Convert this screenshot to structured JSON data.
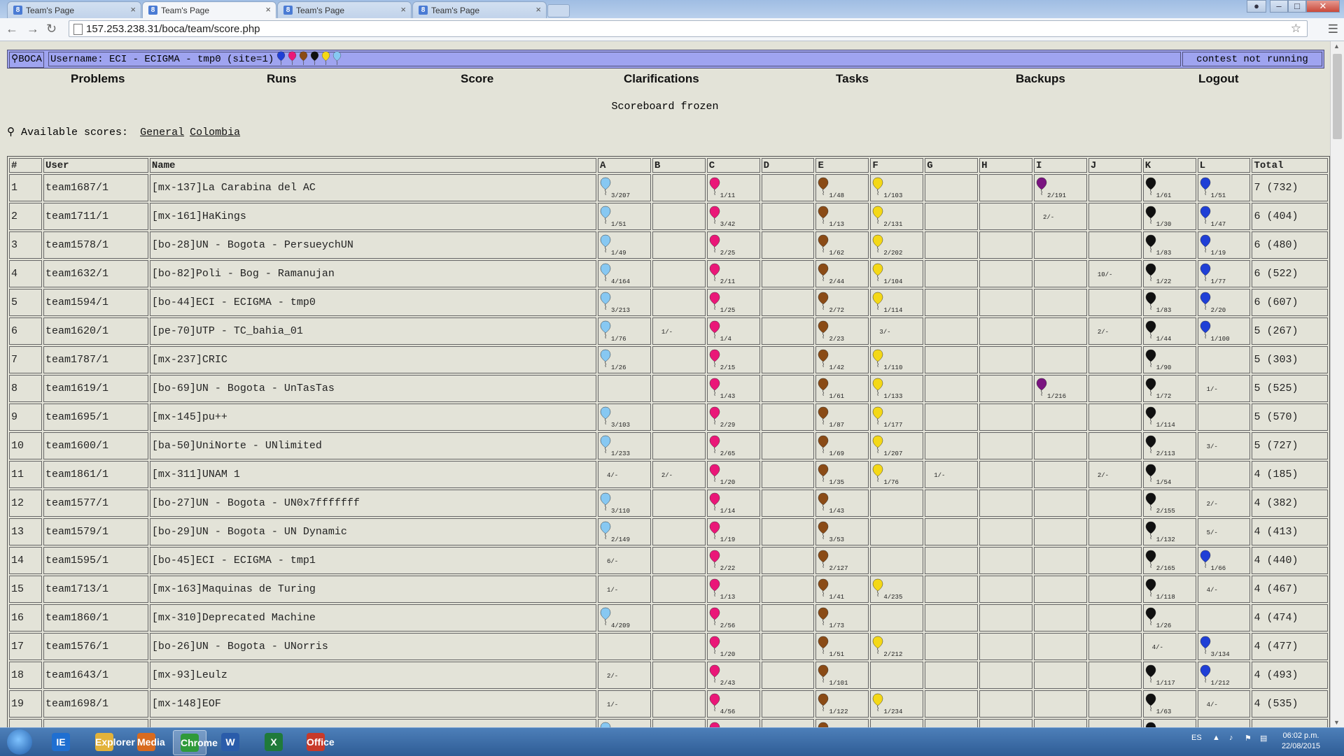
{
  "browser": {
    "tabs": [
      {
        "label": "Team's Page",
        "active": false
      },
      {
        "label": "Team's Page",
        "active": true
      },
      {
        "label": "Team's Page",
        "active": false
      },
      {
        "label": "Team's Page",
        "active": false
      }
    ],
    "close_glyph": "×",
    "url": "157.253.238.31/boca/team/score.php"
  },
  "header": {
    "logo": "BOCA",
    "username": "Username: ECI - ECIGMA - tmp0 (site=1)",
    "status": "contest not running",
    "balloon_colors": [
      "#1f3fd6",
      "#ea1778",
      "#8a4b16",
      "#101010",
      "#f4d817",
      "#87c8f2"
    ]
  },
  "menu": [
    "Problems",
    "Runs",
    "Score",
    "Clarifications",
    "Tasks",
    "Backups",
    "Logout"
  ],
  "notice": "Scoreboard frozen",
  "scores": {
    "label": "Available scores:",
    "links": [
      "General",
      "Colombia"
    ]
  },
  "colors": {
    "A": "#87c8f2",
    "B": "#ffffff",
    "C": "#ea1778",
    "D": "#ffffff",
    "E": "#8a4b16",
    "F": "#f4d817",
    "G": "#ffffff",
    "H": "#ffffff",
    "I": "#7a1480",
    "J": "#ffffff",
    "K": "#101010",
    "L": "#1f3fd6"
  },
  "table": {
    "columns": [
      "#",
      "User",
      "Name",
      "A",
      "B",
      "C",
      "D",
      "E",
      "F",
      "G",
      "H",
      "I",
      "J",
      "K",
      "L",
      "Total"
    ],
    "rows": [
      {
        "rank": "1",
        "user": "team1687/1",
        "name": "[mx-137]La Carabina del AC",
        "total": "7 (732)",
        "cells": [
          "b:3/207",
          "",
          "b:1/11",
          "",
          "b:1/48",
          "b:1/103",
          "",
          "",
          "b:2/191",
          "",
          "b:1/61",
          "b:1/51"
        ]
      },
      {
        "rank": "2",
        "user": "team1711/1",
        "name": "[mx-161]HaKings",
        "total": "6 (404)",
        "cells": [
          "b:1/51",
          "",
          "b:3/42",
          "",
          "b:1/13",
          "b:2/131",
          "",
          "",
          "t:2/-",
          "",
          "b:1/30",
          "b:1/47"
        ]
      },
      {
        "rank": "3",
        "user": "team1578/1",
        "name": "[bo-28]UN - Bogota - PersueychUN",
        "total": "6 (480)",
        "cells": [
          "b:1/49",
          "",
          "b:2/25",
          "",
          "b:1/62",
          "b:2/202",
          "",
          "",
          "",
          "",
          "b:1/83",
          "b:1/19"
        ]
      },
      {
        "rank": "4",
        "user": "team1632/1",
        "name": "[bo-82]Poli - Bog - Ramanujan",
        "total": "6 (522)",
        "cells": [
          "b:4/164",
          "",
          "b:2/11",
          "",
          "b:2/44",
          "b:1/104",
          "",
          "",
          "",
          "t:10/-",
          "b:1/22",
          "b:1/77"
        ]
      },
      {
        "rank": "5",
        "user": "team1594/1",
        "name": "[bo-44]ECI - ECIGMA - tmp0",
        "total": "6 (607)",
        "cells": [
          "b:3/213",
          "",
          "b:1/25",
          "",
          "b:2/72",
          "b:1/114",
          "",
          "",
          "",
          "",
          "b:1/83",
          "b:2/20"
        ]
      },
      {
        "rank": "6",
        "user": "team1620/1",
        "name": "[pe-70]UTP - TC_bahia_01",
        "total": "5 (267)",
        "cells": [
          "b:1/76",
          "t:1/-",
          "b:1/4",
          "",
          "b:2/23",
          "t:3/-",
          "",
          "",
          "",
          "t:2/-",
          "b:1/44",
          "b:1/100"
        ]
      },
      {
        "rank": "7",
        "user": "team1787/1",
        "name": "[mx-237]CRIC",
        "total": "5 (303)",
        "cells": [
          "b:1/26",
          "",
          "b:2/15",
          "",
          "b:1/42",
          "b:1/110",
          "",
          "",
          "",
          "",
          "b:1/90",
          ""
        ]
      },
      {
        "rank": "8",
        "user": "team1619/1",
        "name": "[bo-69]UN - Bogota - UnTasTas",
        "total": "5 (525)",
        "cells": [
          "",
          "",
          "b:1/43",
          "",
          "b:1/61",
          "b:1/133",
          "",
          "",
          "b:1/216",
          "",
          "b:1/72",
          "t:1/-"
        ]
      },
      {
        "rank": "9",
        "user": "team1695/1",
        "name": "[mx-145]pu++",
        "total": "5 (570)",
        "cells": [
          "b:3/103",
          "",
          "b:2/29",
          "",
          "b:1/87",
          "b:1/177",
          "",
          "",
          "",
          "",
          "b:1/114",
          ""
        ]
      },
      {
        "rank": "10",
        "user": "team1600/1",
        "name": "[ba-50]UniNorte - UNlimited",
        "total": "5 (727)",
        "cells": [
          "b:1/233",
          "",
          "b:2/65",
          "",
          "b:1/69",
          "b:1/207",
          "",
          "",
          "",
          "",
          "b:2/113",
          "t:3/-"
        ]
      },
      {
        "rank": "11",
        "user": "team1861/1",
        "name": "[mx-311]UNAM 1",
        "total": "4 (185)",
        "cells": [
          "t:4/-",
          "t:2/-",
          "b:1/20",
          "",
          "b:1/35",
          "b:1/76",
          "t:1/-",
          "",
          "",
          "t:2/-",
          "b:1/54",
          ""
        ]
      },
      {
        "rank": "12",
        "user": "team1577/1",
        "name": "[bo-27]UN - Bogota - UN0x7fffffff",
        "total": "4 (382)",
        "cells": [
          "b:3/110",
          "",
          "b:1/14",
          "",
          "b:1/43",
          "",
          "",
          "",
          "",
          "",
          "b:2/155",
          "t:2/-"
        ]
      },
      {
        "rank": "13",
        "user": "team1579/1",
        "name": "[bo-29]UN - Bogota - UN Dynamic",
        "total": "4 (413)",
        "cells": [
          "b:2/149",
          "",
          "b:1/19",
          "",
          "b:3/53",
          "",
          "",
          "",
          "",
          "",
          "b:1/132",
          "t:5/-"
        ]
      },
      {
        "rank": "14",
        "user": "team1595/1",
        "name": "[bo-45]ECI - ECIGMA - tmp1",
        "total": "4 (440)",
        "cells": [
          "t:6/-",
          "",
          "b:2/22",
          "",
          "b:2/127",
          "",
          "",
          "",
          "",
          "",
          "b:2/165",
          "b:1/66"
        ]
      },
      {
        "rank": "15",
        "user": "team1713/1",
        "name": "[mx-163]Maquinas de Turing",
        "total": "4 (467)",
        "cells": [
          "t:1/-",
          "",
          "b:1/13",
          "",
          "b:1/41",
          "b:4/235",
          "",
          "",
          "",
          "",
          "b:1/118",
          "t:4/-"
        ]
      },
      {
        "rank": "16",
        "user": "team1860/1",
        "name": "[mx-310]Deprecated Machine",
        "total": "4 (474)",
        "cells": [
          "b:4/209",
          "",
          "b:2/56",
          "",
          "b:1/73",
          "",
          "",
          "",
          "",
          "",
          "b:1/26",
          ""
        ]
      },
      {
        "rank": "17",
        "user": "team1576/1",
        "name": "[bo-26]UN - Bogota - UNorris",
        "total": "4 (477)",
        "cells": [
          "",
          "",
          "b:1/20",
          "",
          "b:1/51",
          "b:2/212",
          "",
          "",
          "",
          "",
          "t:4/-",
          "b:3/134"
        ]
      },
      {
        "rank": "18",
        "user": "team1643/1",
        "name": "[mx-93]Leulz",
        "total": "4 (493)",
        "cells": [
          "t:2/-",
          "",
          "b:2/43",
          "",
          "b:1/101",
          "",
          "",
          "",
          "",
          "",
          "b:1/117",
          "b:1/212"
        ]
      },
      {
        "rank": "19",
        "user": "team1698/1",
        "name": "[mx-148]EOF",
        "total": "4 (535)",
        "cells": [
          "t:1/-",
          "",
          "b:4/56",
          "",
          "b:1/122",
          "b:1/234",
          "",
          "",
          "",
          "",
          "b:1/63",
          "t:4/-"
        ]
      },
      {
        "rank": "",
        "user": "",
        "name": "",
        "total": "",
        "cells": [
          "b:",
          "",
          "b:",
          "",
          "b:",
          "",
          "",
          "",
          "",
          "",
          "b:",
          ""
        ]
      }
    ]
  },
  "taskbar": {
    "apps": [
      "IE",
      "Explorer",
      "Media",
      "Chrome",
      "W",
      "X",
      "Office"
    ],
    "lang": "ES",
    "time": "06:02 p.m.",
    "date": "22/08/2015"
  }
}
